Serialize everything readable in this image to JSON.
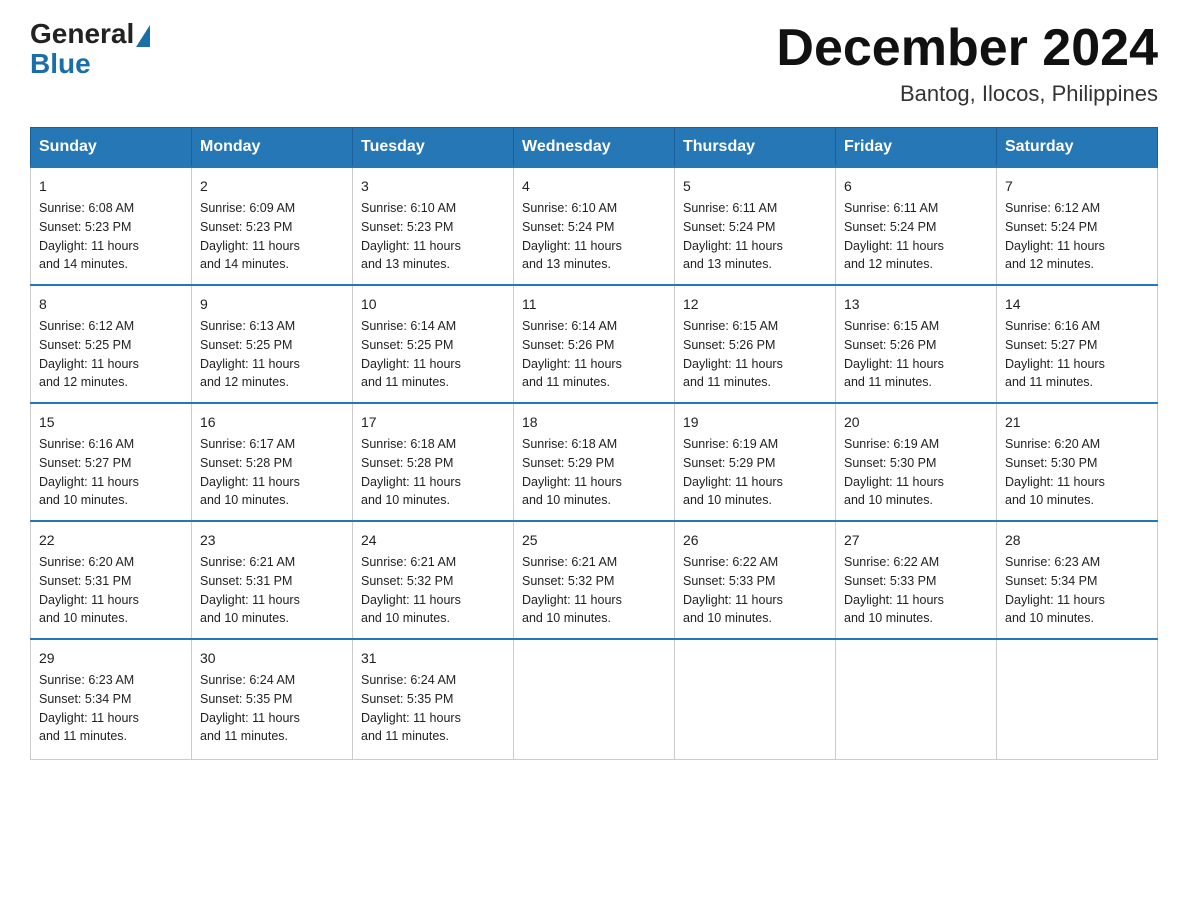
{
  "header": {
    "logo_general": "General",
    "logo_blue": "Blue",
    "month_title": "December 2024",
    "location": "Bantog, Ilocos, Philippines"
  },
  "days_of_week": [
    "Sunday",
    "Monday",
    "Tuesday",
    "Wednesday",
    "Thursday",
    "Friday",
    "Saturday"
  ],
  "weeks": [
    [
      {
        "date": "1",
        "sunrise": "6:08 AM",
        "sunset": "5:23 PM",
        "daylight": "11 hours and 14 minutes."
      },
      {
        "date": "2",
        "sunrise": "6:09 AM",
        "sunset": "5:23 PM",
        "daylight": "11 hours and 14 minutes."
      },
      {
        "date": "3",
        "sunrise": "6:10 AM",
        "sunset": "5:23 PM",
        "daylight": "11 hours and 13 minutes."
      },
      {
        "date": "4",
        "sunrise": "6:10 AM",
        "sunset": "5:24 PM",
        "daylight": "11 hours and 13 minutes."
      },
      {
        "date": "5",
        "sunrise": "6:11 AM",
        "sunset": "5:24 PM",
        "daylight": "11 hours and 13 minutes."
      },
      {
        "date": "6",
        "sunrise": "6:11 AM",
        "sunset": "5:24 PM",
        "daylight": "11 hours and 12 minutes."
      },
      {
        "date": "7",
        "sunrise": "6:12 AM",
        "sunset": "5:24 PM",
        "daylight": "11 hours and 12 minutes."
      }
    ],
    [
      {
        "date": "8",
        "sunrise": "6:12 AM",
        "sunset": "5:25 PM",
        "daylight": "11 hours and 12 minutes."
      },
      {
        "date": "9",
        "sunrise": "6:13 AM",
        "sunset": "5:25 PM",
        "daylight": "11 hours and 12 minutes."
      },
      {
        "date": "10",
        "sunrise": "6:14 AM",
        "sunset": "5:25 PM",
        "daylight": "11 hours and 11 minutes."
      },
      {
        "date": "11",
        "sunrise": "6:14 AM",
        "sunset": "5:26 PM",
        "daylight": "11 hours and 11 minutes."
      },
      {
        "date": "12",
        "sunrise": "6:15 AM",
        "sunset": "5:26 PM",
        "daylight": "11 hours and 11 minutes."
      },
      {
        "date": "13",
        "sunrise": "6:15 AM",
        "sunset": "5:26 PM",
        "daylight": "11 hours and 11 minutes."
      },
      {
        "date": "14",
        "sunrise": "6:16 AM",
        "sunset": "5:27 PM",
        "daylight": "11 hours and 11 minutes."
      }
    ],
    [
      {
        "date": "15",
        "sunrise": "6:16 AM",
        "sunset": "5:27 PM",
        "daylight": "11 hours and 10 minutes."
      },
      {
        "date": "16",
        "sunrise": "6:17 AM",
        "sunset": "5:28 PM",
        "daylight": "11 hours and 10 minutes."
      },
      {
        "date": "17",
        "sunrise": "6:18 AM",
        "sunset": "5:28 PM",
        "daylight": "11 hours and 10 minutes."
      },
      {
        "date": "18",
        "sunrise": "6:18 AM",
        "sunset": "5:29 PM",
        "daylight": "11 hours and 10 minutes."
      },
      {
        "date": "19",
        "sunrise": "6:19 AM",
        "sunset": "5:29 PM",
        "daylight": "11 hours and 10 minutes."
      },
      {
        "date": "20",
        "sunrise": "6:19 AM",
        "sunset": "5:30 PM",
        "daylight": "11 hours and 10 minutes."
      },
      {
        "date": "21",
        "sunrise": "6:20 AM",
        "sunset": "5:30 PM",
        "daylight": "11 hours and 10 minutes."
      }
    ],
    [
      {
        "date": "22",
        "sunrise": "6:20 AM",
        "sunset": "5:31 PM",
        "daylight": "11 hours and 10 minutes."
      },
      {
        "date": "23",
        "sunrise": "6:21 AM",
        "sunset": "5:31 PM",
        "daylight": "11 hours and 10 minutes."
      },
      {
        "date": "24",
        "sunrise": "6:21 AM",
        "sunset": "5:32 PM",
        "daylight": "11 hours and 10 minutes."
      },
      {
        "date": "25",
        "sunrise": "6:21 AM",
        "sunset": "5:32 PM",
        "daylight": "11 hours and 10 minutes."
      },
      {
        "date": "26",
        "sunrise": "6:22 AM",
        "sunset": "5:33 PM",
        "daylight": "11 hours and 10 minutes."
      },
      {
        "date": "27",
        "sunrise": "6:22 AM",
        "sunset": "5:33 PM",
        "daylight": "11 hours and 10 minutes."
      },
      {
        "date": "28",
        "sunrise": "6:23 AM",
        "sunset": "5:34 PM",
        "daylight": "11 hours and 10 minutes."
      }
    ],
    [
      {
        "date": "29",
        "sunrise": "6:23 AM",
        "sunset": "5:34 PM",
        "daylight": "11 hours and 11 minutes."
      },
      {
        "date": "30",
        "sunrise": "6:24 AM",
        "sunset": "5:35 PM",
        "daylight": "11 hours and 11 minutes."
      },
      {
        "date": "31",
        "sunrise": "6:24 AM",
        "sunset": "5:35 PM",
        "daylight": "11 hours and 11 minutes."
      },
      null,
      null,
      null,
      null
    ]
  ],
  "labels": {
    "sunrise": "Sunrise:",
    "sunset": "Sunset:",
    "daylight": "Daylight:"
  }
}
